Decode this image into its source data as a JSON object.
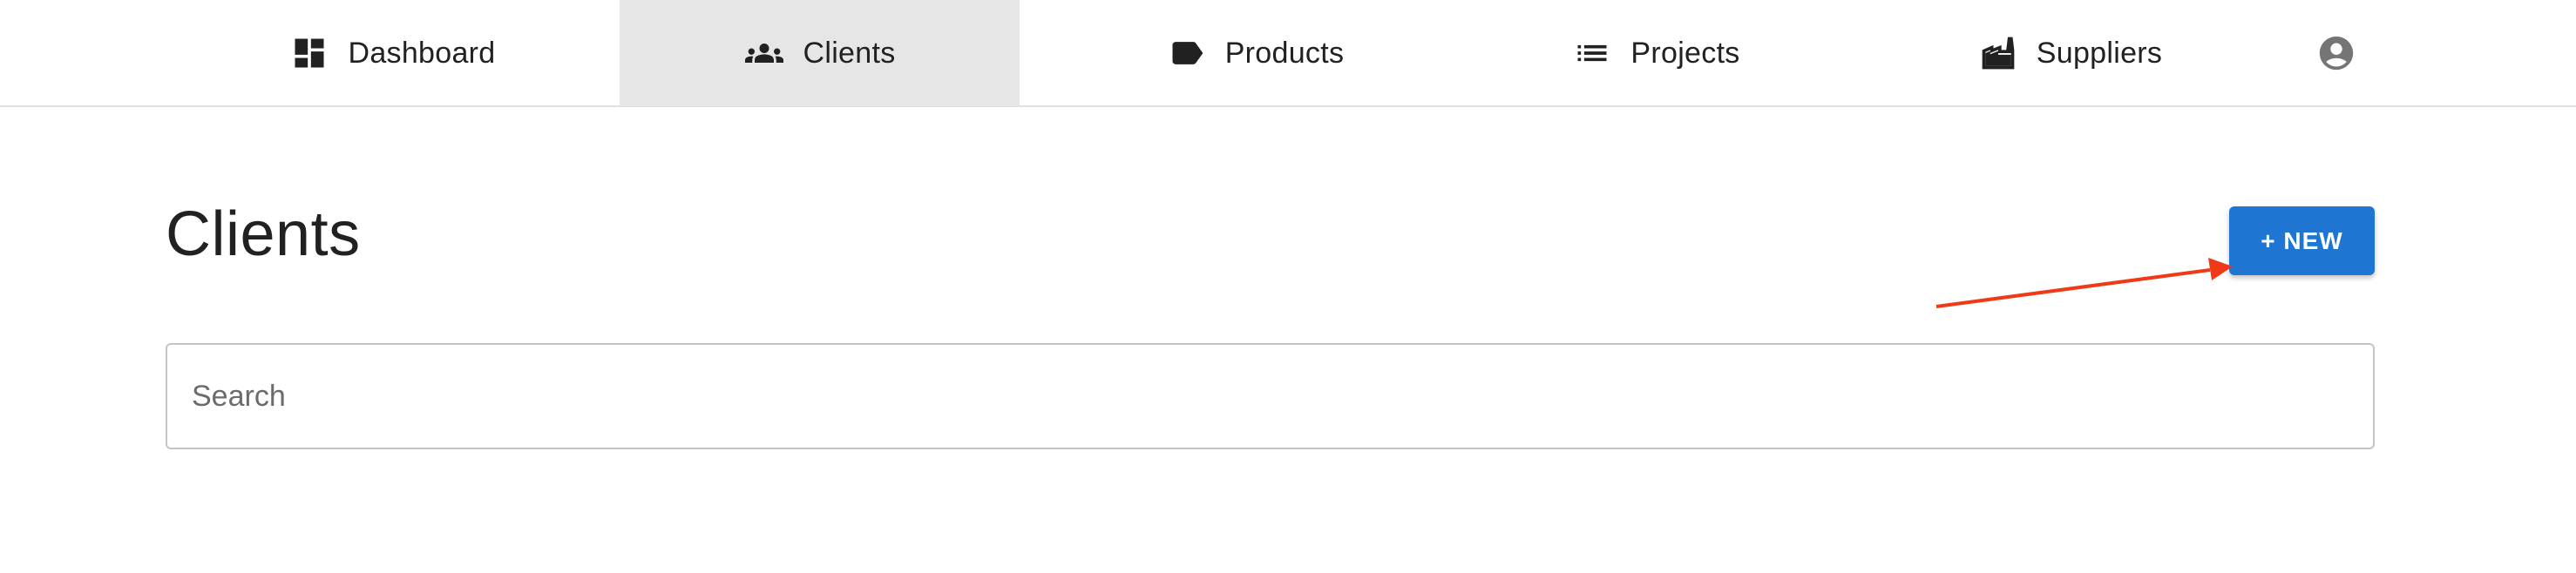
{
  "nav": {
    "tabs": [
      {
        "label": "Dashboard",
        "icon": "dashboard-icon"
      },
      {
        "label": "Clients",
        "icon": "people-icon",
        "active": true
      },
      {
        "label": "Products",
        "icon": "label-tag-icon"
      },
      {
        "label": "Projects",
        "icon": "list-icon"
      },
      {
        "label": "Suppliers",
        "icon": "factory-icon"
      }
    ],
    "avatar_icon": "account-circle-icon"
  },
  "main": {
    "title": "Clients",
    "new_button_label": "+ NEW",
    "search": {
      "placeholder": "Search",
      "value": ""
    }
  },
  "colors": {
    "accent": "#1e76d2",
    "active_tab_bg": "#e6e6e6",
    "annotation_arrow": "#f03a17"
  }
}
